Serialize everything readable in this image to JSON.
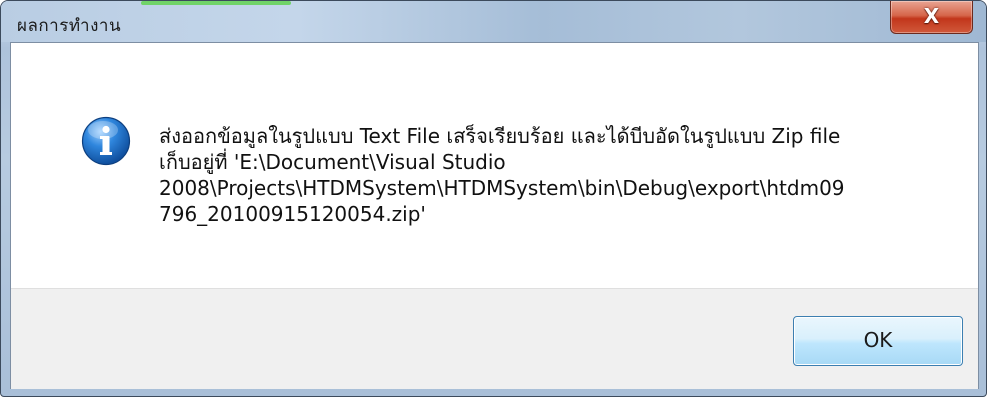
{
  "dialog": {
    "title": "ผลการทำงาน",
    "close_glyph": "X",
    "icon": "information-icon",
    "message_lines": [
      "ส่งออกข้อมูลในรูปแบบ Text File เสร็จเรียบร้อย และได้บีบอัดในรูปแบบ Zip file",
      "เก็บอยู่ที่ 'E:\\Document\\Visual Studio",
      "2008\\Projects\\HTDMSystem\\HTDMSystem\\bin\\Debug\\export\\htdm09",
      "796_20100915120054.zip'"
    ],
    "ok_label": "OK"
  },
  "colors": {
    "close_button": "#c2361b",
    "ok_border": "#3c7fb1",
    "info_icon": "#1f6fc4"
  }
}
